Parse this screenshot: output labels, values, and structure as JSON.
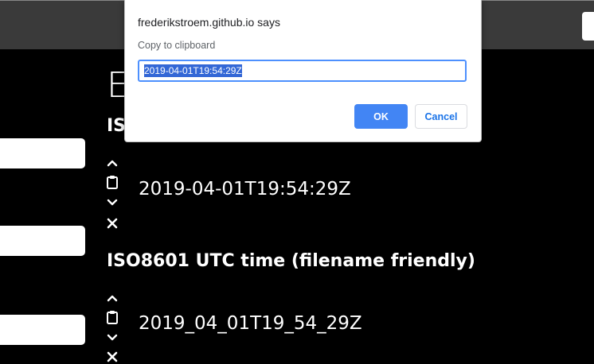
{
  "dialog": {
    "origin": "frederikstroem.github.io says",
    "message": "Copy to clipboard",
    "input_value": "2019-04-01T19:54:29Z",
    "ok_label": "OK",
    "cancel_label": "Cancel"
  },
  "page": {
    "heading_partial": "E",
    "sections": [
      {
        "title": "ISO",
        "value": "2019-04-01T19:54:29Z"
      },
      {
        "title": "ISO8601 UTC time (filename friendly)",
        "value": "2019_04_01T19_54_29Z"
      }
    ]
  },
  "icons": {
    "up": "chevron-up-icon",
    "copy": "clipboard-icon",
    "down": "chevron-down-icon",
    "remove": "close-icon"
  }
}
